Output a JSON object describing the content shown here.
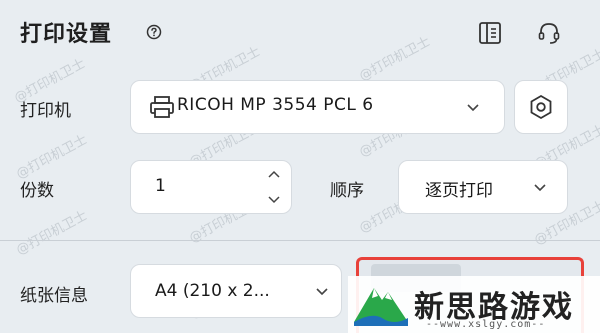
{
  "header": {
    "title": "打印设置"
  },
  "watermark_text": "@打印机卫士",
  "printer": {
    "label": "打印机",
    "value": "RICOH MP 3554 PCL 6"
  },
  "copies": {
    "label": "份数",
    "value": "1"
  },
  "order": {
    "label": "顺序",
    "value": "逐页打印"
  },
  "paper": {
    "label": "纸张信息",
    "value": "A4 (210 x 2..."
  },
  "logo": {
    "name": "新思路游戏",
    "url_text": "--www.xslgy.com--"
  },
  "colors": {
    "background": "#e8edf1",
    "highlight_border": "#e8413a",
    "logo_green": "#2aa84a",
    "logo_blue": "#1d6fb8"
  },
  "icons": {
    "help": "question-circle-icon",
    "layout": "layout-panel-icon",
    "support": "headset-icon",
    "printer": "printer-icon",
    "settings": "hexagon-settings-icon",
    "dropdown": "chevron-down-icon",
    "stepper_up": "chevron-up-icon",
    "stepper_down": "chevron-down-icon"
  }
}
